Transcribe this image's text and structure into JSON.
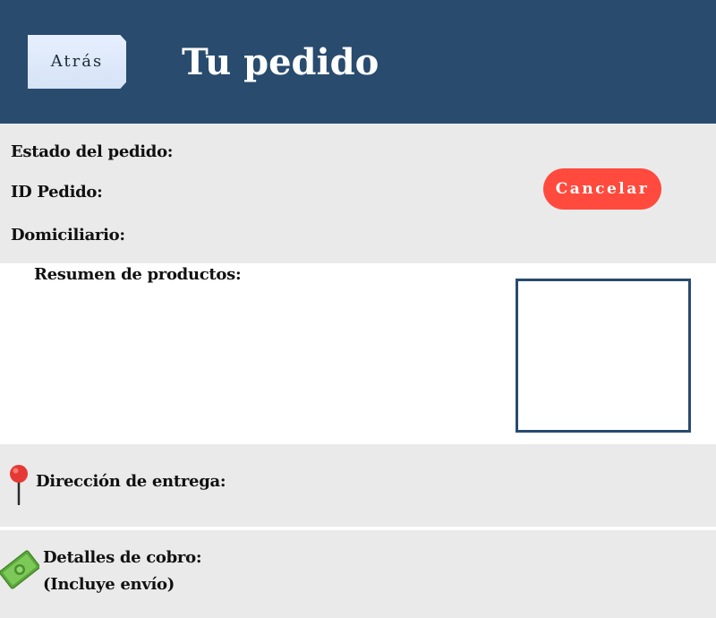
{
  "header": {
    "back_label": "Atrás",
    "title": "Tu pedido"
  },
  "order_status": {
    "status_label": "Estado del pedido:",
    "id_label": "ID Pedido:",
    "courier_label": "Domiciliario:",
    "cancel_label": "Cancelar"
  },
  "products": {
    "title": "Resumen de productos:"
  },
  "delivery": {
    "icon": "map-pin-icon",
    "label": "Dirección de entrega:"
  },
  "billing": {
    "icon": "money-icon",
    "label": "Detalles de cobro:",
    "note": "(Incluye envío)"
  },
  "colors": {
    "header_bg": "#284b6e",
    "section_bg": "#eaeaea",
    "cancel_bg": "#ff4a3d",
    "back_bg": "#dde8fb"
  }
}
